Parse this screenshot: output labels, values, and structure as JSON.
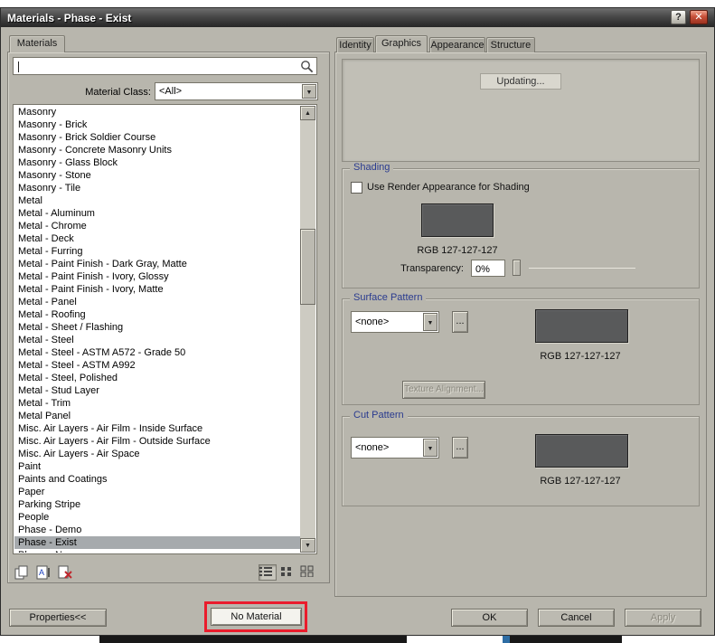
{
  "window": {
    "title": "Materials - Phase - Exist"
  },
  "glyphs": {
    "help": "?",
    "close": "✕",
    "dropdown_arrow": "▼",
    "scroll_up": "▲",
    "scroll_down": "▼",
    "browse": "..."
  },
  "left_panel": {
    "tab_label": "Materials",
    "search_value": "",
    "material_class_label": "Material Class:",
    "material_class_value": "<All>",
    "selected_material": "Phase - Exist",
    "materials": [
      "Masonry",
      "Masonry - Brick",
      "Masonry - Brick Soldier Course",
      "Masonry - Concrete Masonry Units",
      "Masonry - Glass Block",
      "Masonry - Stone",
      "Masonry - Tile",
      "Metal",
      "Metal - Aluminum",
      "Metal - Chrome",
      "Metal - Deck",
      "Metal - Furring",
      "Metal - Paint Finish - Dark Gray, Matte",
      "Metal - Paint Finish - Ivory, Glossy",
      "Metal - Paint Finish - Ivory, Matte",
      "Metal - Panel",
      "Metal - Roofing",
      "Metal - Sheet / Flashing",
      "Metal - Steel",
      "Metal - Steel - ASTM A572 - Grade 50",
      "Metal - Steel - ASTM A992",
      "Metal - Steel, Polished",
      "Metal - Stud Layer",
      "Metal - Trim",
      "Metal Panel",
      "Misc. Air Layers - Air Film - Inside Surface",
      "Misc. Air Layers - Air Film - Outside Surface",
      "Misc. Air Layers - Air Space",
      "Paint",
      "Paints and Coatings",
      "Paper",
      "Parking Stripe",
      "People",
      "Phase - Demo",
      "Phase - Exist",
      "Phase - New"
    ]
  },
  "right_panel": {
    "tabs": [
      "Identity",
      "Graphics",
      "Appearance",
      "Structure"
    ],
    "active_tab": "Graphics",
    "preview_status": "Updating...",
    "shading": {
      "title": "Shading",
      "checkbox_label": "Use Render Appearance for Shading",
      "checkbox_checked": false,
      "rgb": "RGB 127-127-127",
      "transparency_label": "Transparency:",
      "transparency_value": "0%"
    },
    "surface_pattern": {
      "title": "Surface Pattern",
      "pattern_value": "<none>",
      "rgb": "RGB 127-127-127",
      "texture_alignment_label": "Texture Alignment..."
    },
    "cut_pattern": {
      "title": "Cut Pattern",
      "pattern_value": "<none>",
      "rgb": "RGB 127-127-127"
    }
  },
  "footer": {
    "properties_label": "Properties<<",
    "no_material_label": "No Material",
    "ok_label": "OK",
    "cancel_label": "Cancel",
    "apply_label": "Apply"
  },
  "colors": {
    "annotation_red": "#ea1c2c",
    "swatch_gray": "#595a5b",
    "group_label_blue": "#2a3b8f"
  }
}
